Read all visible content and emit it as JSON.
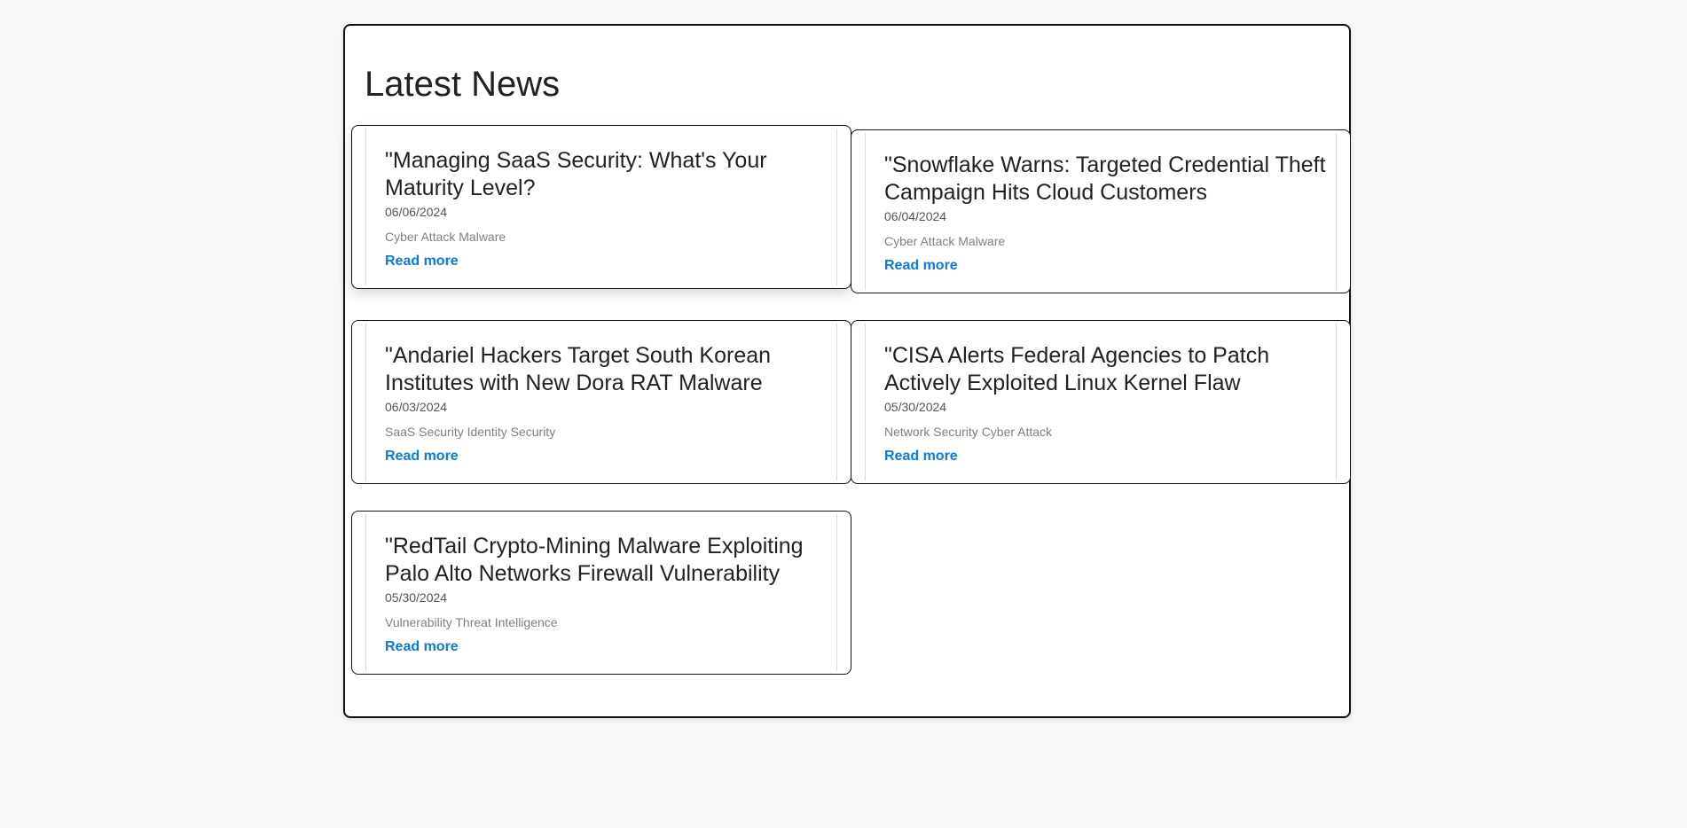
{
  "page": {
    "title": "Latest News"
  },
  "articles": [
    {
      "title": "\"Managing SaaS Security: What's Your Maturity Level?",
      "date": "06/06/2024",
      "tags": "Cyber Attack Malware",
      "link": "Read more"
    },
    {
      "title": "\"Snowflake Warns: Targeted Credential Theft Campaign Hits Cloud Customers",
      "date": "06/04/2024",
      "tags": "Cyber Attack Malware",
      "link": "Read more"
    },
    {
      "title": "\"Andariel Hackers Target South Korean Institutes with New Dora RAT Malware",
      "date": "06/03/2024",
      "tags": "SaaS Security Identity Security",
      "link": "Read more"
    },
    {
      "title": "\"CISA Alerts Federal Agencies to Patch Actively Exploited Linux Kernel Flaw",
      "date": "05/30/2024",
      "tags": "Network Security Cyber Attack",
      "link": "Read more"
    },
    {
      "title": "\"RedTail Crypto-Mining Malware Exploiting Palo Alto Networks Firewall Vulnerability",
      "date": "05/30/2024",
      "tags": "Vulnerability Threat Intelligence",
      "link": "Read more"
    }
  ],
  "colors": {
    "link": "#0a7bdd",
    "background": "#f7f8fa",
    "border": "#111111"
  }
}
